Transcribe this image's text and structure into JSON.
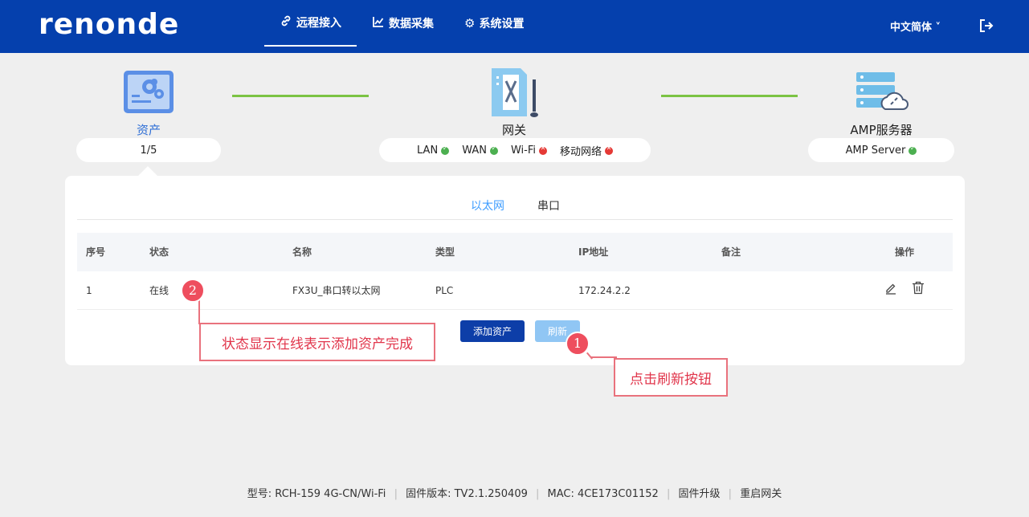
{
  "header": {
    "logo": "renonde",
    "nav": [
      {
        "label": "远程接入",
        "icon": "link-icon"
      },
      {
        "label": "数据采集",
        "icon": "chart-icon"
      },
      {
        "label": "系统设置",
        "icon": "gear-icon"
      }
    ],
    "language": "中文简体",
    "language_arrow": "chevron-down-icon",
    "logout_icon": "logout-icon"
  },
  "topology": {
    "asset": {
      "label": "资产",
      "count": "1/5",
      "icon": "asset-config-icon"
    },
    "gateway": {
      "label": "网关",
      "icon": "gateway-device-icon",
      "statuses": [
        {
          "name": "LAN",
          "state": "ok"
        },
        {
          "name": "WAN",
          "state": "ok"
        },
        {
          "name": "Wi-Fi",
          "state": "error"
        },
        {
          "name": "移动网络",
          "state": "error"
        }
      ]
    },
    "server": {
      "label": "AMP服务器",
      "status_name": "AMP Server",
      "state": "ok",
      "icon": "cloud-server-icon"
    },
    "colors": {
      "ok": "#4caf50",
      "error": "#e53935",
      "connector": "#7bc343"
    }
  },
  "tabs": [
    {
      "label": "以太网",
      "active": true
    },
    {
      "label": "串口",
      "active": false
    }
  ],
  "table": {
    "columns": [
      "序号",
      "状态",
      "名称",
      "类型",
      "IP地址",
      "备注",
      "操作"
    ],
    "rows": [
      {
        "index": "1",
        "status": "在线",
        "name": "FX3U_串口转以太网",
        "type": "PLC",
        "ip": "172.24.2.2",
        "remark": ""
      }
    ]
  },
  "buttons": {
    "add": "添加资产",
    "refresh": "刷新"
  },
  "annotations": [
    {
      "number": "1",
      "text": "点击刷新按钮"
    },
    {
      "number": "2",
      "text": "状态显示在线表示添加资产完成"
    }
  ],
  "footer": {
    "model": "型号:  RCH-159  4G-CN/Wi-Fi",
    "firmware": "固件版本:  TV2.1.250409",
    "mac": "MAC:  4CE173C01152",
    "upgrade": "固件升级",
    "reboot": "重启网关"
  }
}
